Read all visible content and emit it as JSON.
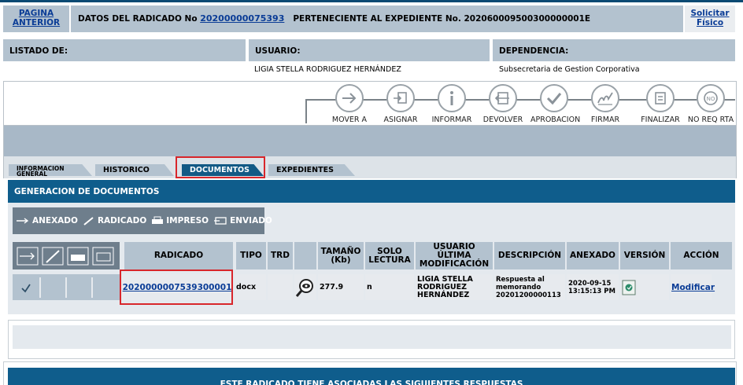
{
  "header": {
    "prev_page_line1": "PAGINA",
    "prev_page_line2": "ANTERIOR",
    "radicado_prefix": "DATOS DEL RADICADO No",
    "radicado_number": "20200000075393",
    "expediente_text": "PERTENECIENTE AL EXPEDIENTE No. 202060009500300000001E",
    "solicitar_line1": "Solicitar",
    "solicitar_line2": "Físico"
  },
  "info": {
    "listado_label": "LISTADO DE:",
    "usuario_label": "USUARIO:",
    "dependencia_label": "DEPENDENCIA:",
    "usuario_value": "LIGIA STELLA RODRIGUEZ HERNÁNDEZ",
    "dependencia_value": "Subsecretaria de Gestion Corporativa"
  },
  "actions": [
    {
      "label": "MOVER A",
      "icon": "arrow-right-icon"
    },
    {
      "label": "ASIGNAR",
      "icon": "assign-icon"
    },
    {
      "label": "INFORMAR",
      "icon": "info-icon"
    },
    {
      "label": "DEVOLVER",
      "icon": "return-icon"
    },
    {
      "label": "APROBACION",
      "icon": "check-icon"
    },
    {
      "label": "FIRMAR",
      "icon": "sign-icon"
    },
    {
      "label": "FINALIZAR",
      "icon": "finish-icon"
    },
    {
      "label": "NO REQ RTA",
      "icon": "no-response-icon"
    }
  ],
  "tabs": {
    "info_general_1": "INFORMACION",
    "info_general_2": "GENERAL",
    "historico": "HISTORICO",
    "documentos": "DOCUMENTOS",
    "expedientes": "EXPEDIENTES"
  },
  "section_title": "GENERACION DE DOCUMENTOS",
  "legend": {
    "anexado": "ANEXADO",
    "radicado": "RADICADO",
    "impreso": "IMPRESO",
    "enviado": "ENVIADO"
  },
  "table": {
    "headers": {
      "radicado": "RADICADO",
      "tipo": "TIPO",
      "trd": "TRD",
      "tamano_1": "TAMAÑO",
      "tamano_2": "(Kb)",
      "solo_1": "SOLO",
      "solo_2": "LECTURA",
      "usuario_1": "USUARIO",
      "usuario_2": "ÚLTIMA",
      "usuario_3": "MODIFICACIÓN",
      "descripcion": "DESCRIPCIÓN",
      "anexado": "ANEXADO",
      "version": "VERSIÓN",
      "accion": "ACCIÓN"
    },
    "row": {
      "radicado": "2020000007539300001",
      "tipo": "docx",
      "tamano": "277.9",
      "solo_lectura": "n",
      "usuario_1": "LIGIA STELLA",
      "usuario_2": "RODRIGUEZ",
      "usuario_3": "HERNÁNDEZ",
      "desc_1": "Respuesta al",
      "desc_2": "memorando",
      "desc_3": "20201200000113",
      "fecha_1": "2020-09-15",
      "fecha_2": "13:15:13 PM",
      "accion": "Modificar"
    }
  },
  "bottom_title": "ESTE RADICADO TIENE ASOCIADAS LAS SIGUIENTES RESPUESTAS",
  "colors": {
    "dark_blue": "#0f5d8c",
    "header_gray": "#b3c2cf",
    "highlight_red": "#d8262b"
  }
}
